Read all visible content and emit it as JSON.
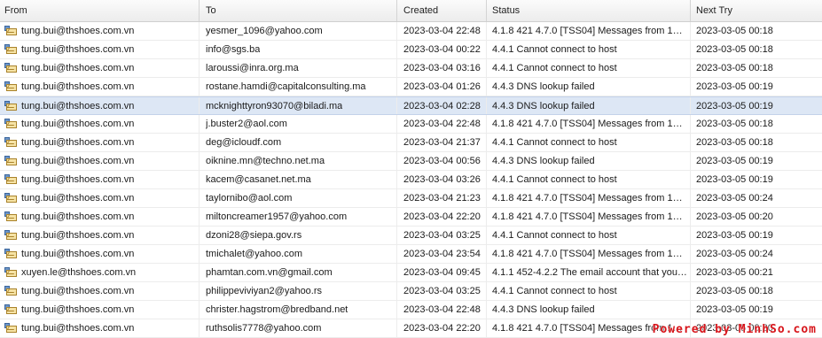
{
  "columns": {
    "from": "From",
    "to": "To",
    "created": "Created",
    "status": "Status",
    "next": "Next Try"
  },
  "rows": [
    {
      "from": "tung.bui@thshoes.com.vn",
      "to": "yesmer_1096@yahoo.com",
      "created": "2023-03-04 22:48",
      "status": "4.1.8 421 4.7.0 [TSS04] Messages from 1…",
      "next": "2023-03-05 00:18"
    },
    {
      "from": "tung.bui@thshoes.com.vn",
      "to": "info@sgs.ba",
      "created": "2023-03-04 00:22",
      "status": "4.4.1 Cannot connect to host",
      "next": "2023-03-05 00:18"
    },
    {
      "from": "tung.bui@thshoes.com.vn",
      "to": "laroussi@inra.org.ma",
      "created": "2023-03-04 03:16",
      "status": "4.4.1 Cannot connect to host",
      "next": "2023-03-05 00:18"
    },
    {
      "from": "tung.bui@thshoes.com.vn",
      "to": "rostane.hamdi@capitalconsulting.ma",
      "created": "2023-03-04 01:26",
      "status": "4.4.3 DNS lookup failed",
      "next": "2023-03-05 00:19"
    },
    {
      "from": "tung.bui@thshoes.com.vn",
      "to": "mcknighttyron93070@biladi.ma",
      "created": "2023-03-04 02:28",
      "status": "4.4.3 DNS lookup failed",
      "next": "2023-03-05 00:19"
    },
    {
      "from": "tung.bui@thshoes.com.vn",
      "to": "j.buster2@aol.com",
      "created": "2023-03-04 22:48",
      "status": "4.1.8 421 4.7.0 [TSS04] Messages from 1…",
      "next": "2023-03-05 00:18"
    },
    {
      "from": "tung.bui@thshoes.com.vn",
      "to": "deg@icloudf.com",
      "created": "2023-03-04 21:37",
      "status": "4.4.1 Cannot connect to host",
      "next": "2023-03-05 00:18"
    },
    {
      "from": "tung.bui@thshoes.com.vn",
      "to": "oiknine.mn@techno.net.ma",
      "created": "2023-03-04 00:56",
      "status": "4.4.3 DNS lookup failed",
      "next": "2023-03-05 00:19"
    },
    {
      "from": "tung.bui@thshoes.com.vn",
      "to": "kacem@casanet.net.ma",
      "created": "2023-03-04 03:26",
      "status": "4.4.1 Cannot connect to host",
      "next": "2023-03-05 00:19"
    },
    {
      "from": "tung.bui@thshoes.com.vn",
      "to": "taylornibo@aol.com",
      "created": "2023-03-04 21:23",
      "status": "4.1.8 421 4.7.0 [TSS04] Messages from 1…",
      "next": "2023-03-05 00:24"
    },
    {
      "from": "tung.bui@thshoes.com.vn",
      "to": "miltoncreamer1957@yahoo.com",
      "created": "2023-03-04 22:20",
      "status": "4.1.8 421 4.7.0 [TSS04] Messages from 1…",
      "next": "2023-03-05 00:20"
    },
    {
      "from": "tung.bui@thshoes.com.vn",
      "to": "dzoni28@siepa.gov.rs",
      "created": "2023-03-04 03:25",
      "status": "4.4.1 Cannot connect to host",
      "next": "2023-03-05 00:19"
    },
    {
      "from": "tung.bui@thshoes.com.vn",
      "to": "tmichalet@yahoo.com",
      "created": "2023-03-04 23:54",
      "status": "4.1.8 421 4.7.0 [TSS04] Messages from 1…",
      "next": "2023-03-05 00:24"
    },
    {
      "from": "xuyen.le@thshoes.com.vn",
      "to": "phamtan.com.vn@gmail.com",
      "created": "2023-03-04 09:45",
      "status": "4.1.1 452-4.2.2 The email account that you…",
      "next": "2023-03-05 00:21"
    },
    {
      "from": "tung.bui@thshoes.com.vn",
      "to": "philippeviviyan2@yahoo.rs",
      "created": "2023-03-04 03:25",
      "status": "4.4.1 Cannot connect to host",
      "next": "2023-03-05 00:18"
    },
    {
      "from": "tung.bui@thshoes.com.vn",
      "to": "christer.hagstrom@bredband.net",
      "created": "2023-03-04 22:48",
      "status": "4.4.3 DNS lookup failed",
      "next": "2023-03-05 00:19"
    },
    {
      "from": "tung.bui@thshoes.com.vn",
      "to": "ruthsolis7778@yahoo.com",
      "created": "2023-03-04 22:20",
      "status": "4.1.8 421 4.7.0 [TSS04] Messages from 1…",
      "next": "2023-03-05 00:20"
    }
  ],
  "selected_row": 4,
  "row_icon": "queued-mail-icon",
  "watermark": "Powered by MinhSo.com",
  "colors": {
    "selection": "#dde7f5",
    "watermark": "#d7141a"
  }
}
